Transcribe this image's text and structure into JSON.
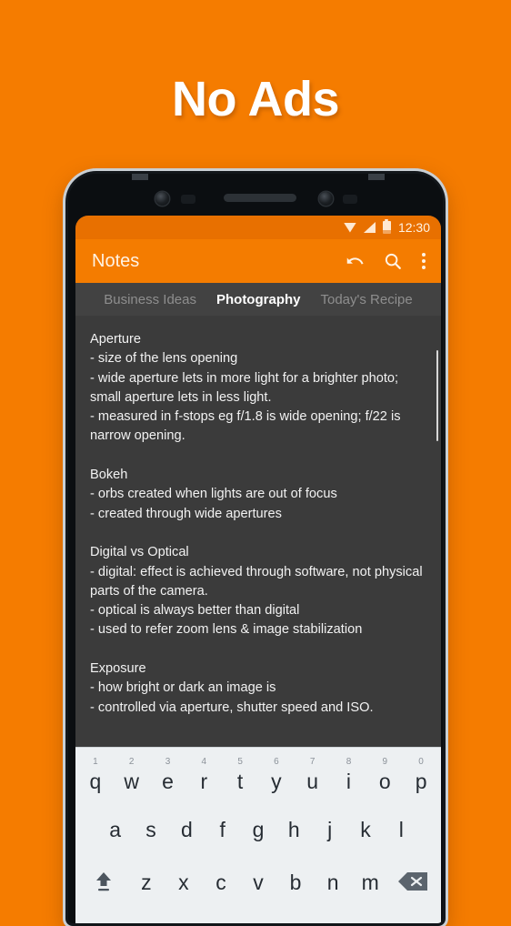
{
  "headline": "No Ads",
  "colors": {
    "background": "#F57C00",
    "app_bar": "#F47C00",
    "status_bar": "#E87000",
    "note_background": "#3B3B3B",
    "tab_bar": "#424242",
    "keyboard": "#EDF0F2",
    "active_tab_text": "#FFFFFF",
    "inactive_tab_text": "#8E8E8E"
  },
  "phone": {
    "status_bar": {
      "clock": "12:30",
      "icons": [
        "wifi-icon",
        "signal-icon",
        "battery-icon"
      ]
    },
    "app_bar": {
      "title": "Notes",
      "actions": [
        {
          "name": "undo-icon",
          "label": "Undo"
        },
        {
          "name": "search-icon",
          "label": "Search"
        },
        {
          "name": "overflow-menu-icon",
          "label": "More options"
        }
      ]
    },
    "tabs": [
      {
        "label": "Business Ideas",
        "active": false
      },
      {
        "label": "Photography",
        "active": true
      },
      {
        "label": "Today's Recipe",
        "active": false
      }
    ],
    "note": {
      "body": "Aperture\n- size of the lens opening\n- wide aperture lets in more light for a brighter photo; small aperture lets in less light.\n- measured in f-stops eg f/1.8 is wide opening; f/22 is narrow opening.\n\nBokeh\n- orbs created when lights are out of focus\n- created through wide apertures\n\nDigital vs Optical\n- digital: effect is achieved through software, not physical parts of the camera.\n- optical is always better than digital\n- used to refer zoom lens & image stabilization\n\nExposure\n- how bright or dark an image is\n- controlled via aperture, shutter speed and ISO."
    },
    "keyboard": {
      "row1": [
        {
          "letter": "q",
          "num": "1"
        },
        {
          "letter": "w",
          "num": "2"
        },
        {
          "letter": "e",
          "num": "3"
        },
        {
          "letter": "r",
          "num": "4"
        },
        {
          "letter": "t",
          "num": "5"
        },
        {
          "letter": "y",
          "num": "6"
        },
        {
          "letter": "u",
          "num": "7"
        },
        {
          "letter": "i",
          "num": "8"
        },
        {
          "letter": "o",
          "num": "9"
        },
        {
          "letter": "p",
          "num": "0"
        }
      ],
      "row2": [
        {
          "letter": "a"
        },
        {
          "letter": "s"
        },
        {
          "letter": "d"
        },
        {
          "letter": "f"
        },
        {
          "letter": "g"
        },
        {
          "letter": "h"
        },
        {
          "letter": "j"
        },
        {
          "letter": "k"
        },
        {
          "letter": "l"
        }
      ],
      "row3": [
        {
          "letter": "z"
        },
        {
          "letter": "x"
        },
        {
          "letter": "c"
        },
        {
          "letter": "v"
        },
        {
          "letter": "b"
        },
        {
          "letter": "n"
        },
        {
          "letter": "m"
        }
      ],
      "shift_key": "shift-key-icon",
      "backspace_key": "backspace-key-icon"
    }
  }
}
